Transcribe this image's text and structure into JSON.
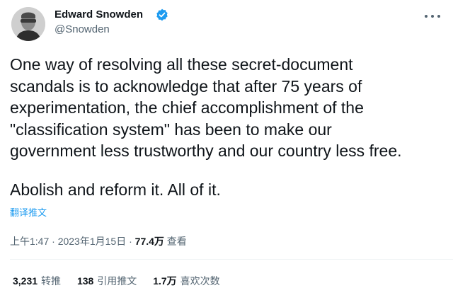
{
  "author": {
    "display_name": "Edward Snowden",
    "handle": "@Snowden",
    "verified": true
  },
  "tweet": {
    "lines": [
      "One way of resolving all these secret-document",
      "scandals is to acknowledge that after 75 years of",
      "experimentation, the chief accomplishment of the",
      "\"classification system\" has been to make our",
      "government less trustworthy and our country less free."
    ],
    "closing": "Abolish and reform it. All of it.",
    "translate_label": "翻译推文"
  },
  "meta": {
    "time": "上午1:47",
    "sep1": " · ",
    "date": "2023年1月15日",
    "sep2": " · ",
    "views": "77.4万",
    "views_label": " 查看"
  },
  "stats": {
    "retweets": {
      "count": "3,231",
      "label": "转推"
    },
    "quotes": {
      "count": "138",
      "label": "引用推文"
    },
    "likes": {
      "count": "1.7万",
      "label": "喜欢次数"
    }
  },
  "colors": {
    "accent": "#1d9bf0",
    "text": "#0f1419",
    "secondary": "#536471",
    "divider": "#eff3f4"
  },
  "icons": {
    "verified": "verified-badge-icon",
    "more": "more-icon"
  }
}
